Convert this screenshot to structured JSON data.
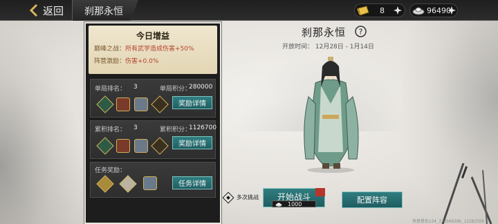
{
  "topbar": {
    "back_label": "返回",
    "title": "刹那永恒",
    "currencies": [
      {
        "icon": "gold-ingot-icon",
        "value": "8"
      },
      {
        "icon": "silver-ingot-icon",
        "value": "96490"
      }
    ]
  },
  "daily_boost": {
    "title": "今日增益",
    "lines": [
      {
        "label": "巅峰之战：",
        "value": "所有武学造成伤害+50%"
      },
      {
        "label": "阵营激励：",
        "value": "伤害+0.0%"
      }
    ]
  },
  "cards": [
    {
      "rank_label": "单局排名：",
      "rank_value": "3",
      "score_label": "单局积分：",
      "score_value": "280000",
      "button": "奖励详情",
      "rewards": [
        "skill-book-icon",
        "chest-icon",
        "hero-portrait-icon",
        "token-icon"
      ]
    },
    {
      "rank_label": "累积排名：",
      "rank_value": "3",
      "score_label": "累积积分：",
      "score_value": "1126700",
      "button": "奖励详情",
      "rewards": [
        "skill-book-icon",
        "chest-icon",
        "hero-portrait-icon",
        "token-icon"
      ]
    },
    {
      "task_label": "任务奖励：",
      "button": "任务详情",
      "rewards": [
        "gold-ingot-icon",
        "scroll-icon",
        "hero-portrait-icon"
      ]
    }
  ],
  "event": {
    "title": "刹那永恒",
    "time": "开放时间：  12月28日 - 1月14日"
  },
  "actions": {
    "multi_label": "多次挑战",
    "start_label": "开始战斗",
    "cost": "1000",
    "formation_label": "配置阵容"
  },
  "watermark": "快意恩仇124_274506396_12281559",
  "colors": {
    "accent": "#2f7d80",
    "panel_bg": "#1d1d1d",
    "boost_bg": "#efe6cf",
    "value_red": "#b4432e"
  }
}
